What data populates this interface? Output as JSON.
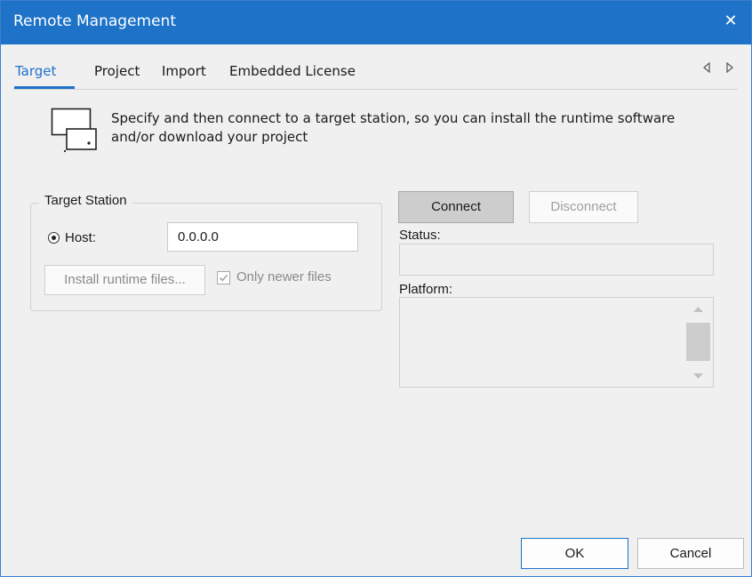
{
  "window": {
    "title": "Remote Management",
    "close_icon": "close-icon"
  },
  "tabs": [
    {
      "label": "Target",
      "active": true
    },
    {
      "label": "Project",
      "active": false
    },
    {
      "label": "Import",
      "active": false
    },
    {
      "label": "Embedded License",
      "active": false
    }
  ],
  "tab_nav": {
    "prev_icon": "chevron-left-icon",
    "next_icon": "chevron-right-icon"
  },
  "intro": {
    "icon": "remote-station-icon",
    "text": "Specify and then connect to a target station, so you can install the runtime software and/or download your project"
  },
  "target_station": {
    "group_label": "Target Station",
    "host_label": "Host:",
    "host_selected": true,
    "host_value": "0.0.0.0",
    "install_button": "Install runtime files...",
    "only_newer_label": "Only newer files",
    "only_newer_checked": true
  },
  "connection": {
    "connect_button": "Connect",
    "disconnect_button": "Disconnect",
    "status_label": "Status:",
    "status_value": "",
    "platform_label": "Platform:",
    "platform_value": ""
  },
  "footer": {
    "ok_button": "OK",
    "cancel_button": "Cancel"
  },
  "colors": {
    "accent": "#1e72c8",
    "background": "#f0f0f0"
  }
}
